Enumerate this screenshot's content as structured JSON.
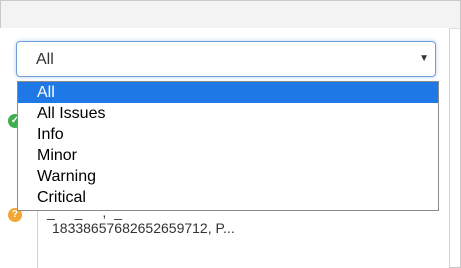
{
  "filter": {
    "selected_value": "All",
    "options": [
      {
        "label": "All",
        "selected": true
      },
      {
        "label": "All Issues",
        "selected": false
      },
      {
        "label": "Info",
        "selected": false
      },
      {
        "label": "Minor",
        "selected": false
      },
      {
        "label": "Warning",
        "selected": false
      },
      {
        "label": "Critical",
        "selected": false
      }
    ],
    "arrow_icon": "dropdown-arrow-icon"
  },
  "background": {
    "partial_text_top": "_ _ ,_",
    "message_text": "1833865768265​2659712, P..."
  },
  "colors": {
    "selection": "#1e78e6",
    "focus_border": "#6f9fd8",
    "success": "#3fae4d",
    "warning": "#f0a733"
  }
}
